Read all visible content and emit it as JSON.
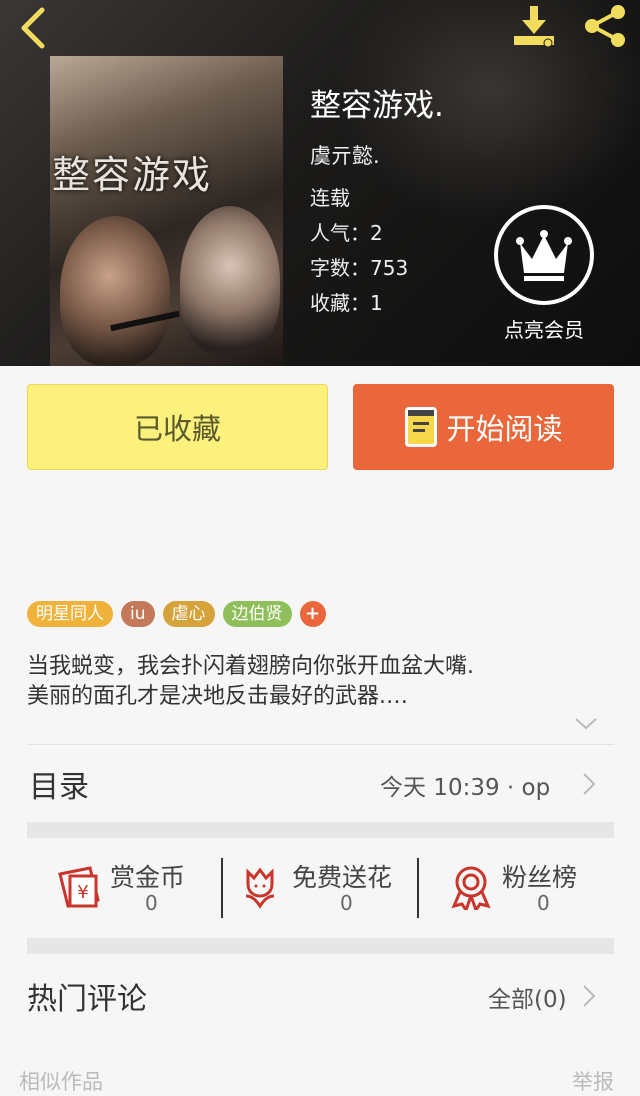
{
  "header": {
    "back_icon": "chevron-left-icon",
    "download_icon": "download-icon",
    "share_icon": "share-icon",
    "icon_color": "#f2dc5d"
  },
  "book": {
    "cover_title": "整容游戏",
    "title": "整容游戏.",
    "author": "虞亓懿.",
    "status": "连载",
    "popularity": "人气：2",
    "word_count": "字数：753",
    "favorites": "收藏：1"
  },
  "vip": {
    "icon": "crown-icon",
    "label": "点亮会员"
  },
  "actions": {
    "collected_label": "已收藏",
    "read_label": "开始阅读",
    "collected_color": "#fcf17c",
    "read_color": "#e9673a"
  },
  "tags": [
    {
      "label": "明星同人",
      "color": "#f0b23a"
    },
    {
      "label": "iu",
      "color": "#c47a5a"
    },
    {
      "label": "虐心",
      "color": "#d6a23a"
    },
    {
      "label": "边伯贤",
      "color": "#8fbf5a"
    },
    {
      "label": "+",
      "color": "#e9673a"
    }
  ],
  "description": {
    "line1": "当我蜕变，我会扑闪着翅膀向你张开血盆大嘴.",
    "line2": "美丽的面孔才是决地反击最好的武器.…"
  },
  "toc": {
    "label": "目录",
    "latest": "今天 10:39 · op"
  },
  "stats": {
    "reward": {
      "label": "赏金币",
      "value": "0",
      "icon": "red-envelope-icon"
    },
    "flower": {
      "label": "免费送花",
      "value": "0",
      "icon": "flower-icon"
    },
    "fans": {
      "label": "粉丝榜",
      "value": "0",
      "icon": "award-ribbon-icon"
    },
    "icon_color": "#c9352b"
  },
  "comments": {
    "label": "热门评论",
    "all_label": "全部(0)"
  },
  "footer": {
    "similar_label": "相似作品",
    "report_label": "举报"
  }
}
